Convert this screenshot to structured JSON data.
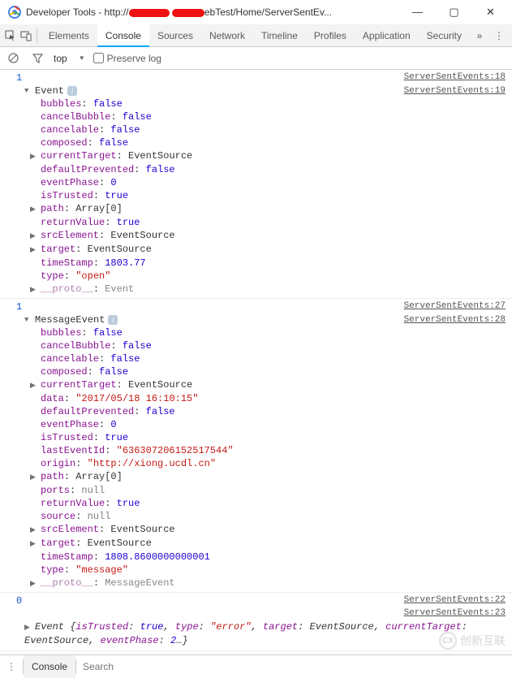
{
  "window": {
    "title_prefix": "Developer Tools - http://",
    "title_mid": "ebTest/Home/ServerSentEv...",
    "btn_min": "—",
    "btn_max": "▢",
    "btn_close": "✕"
  },
  "tabs": {
    "elements": "Elements",
    "console": "Console",
    "sources": "Sources",
    "network": "Network",
    "timeline": "Timeline",
    "profiles": "Profiles",
    "application": "Application",
    "security": "Security",
    "overflow": "»",
    "menu": "⋮"
  },
  "toolbar": {
    "context": "top",
    "preserve_log": "Preserve log"
  },
  "console": {
    "entry1": {
      "count": "1",
      "src_head": "ServerSentEvents:18",
      "obj": "Event",
      "src_obj": "ServerSentEvents:19",
      "props": [
        {
          "k": "bubbles",
          "v": "false",
          "t": "bool"
        },
        {
          "k": "cancelBubble",
          "v": "false",
          "t": "bool"
        },
        {
          "k": "cancelable",
          "v": "false",
          "t": "bool"
        },
        {
          "k": "composed",
          "v": "false",
          "t": "bool"
        },
        {
          "k": "currentTarget",
          "v": "EventSource",
          "t": "obj",
          "exp": true
        },
        {
          "k": "defaultPrevented",
          "v": "false",
          "t": "bool"
        },
        {
          "k": "eventPhase",
          "v": "0",
          "t": "num"
        },
        {
          "k": "isTrusted",
          "v": "true",
          "t": "bool"
        },
        {
          "k": "path",
          "v": "Array[0]",
          "t": "obj",
          "exp": true
        },
        {
          "k": "returnValue",
          "v": "true",
          "t": "bool"
        },
        {
          "k": "srcElement",
          "v": "EventSource",
          "t": "obj",
          "exp": true
        },
        {
          "k": "target",
          "v": "EventSource",
          "t": "obj",
          "exp": true
        },
        {
          "k": "timeStamp",
          "v": "1803.77",
          "t": "num"
        },
        {
          "k": "type",
          "v": "\"open\"",
          "t": "str"
        },
        {
          "k": "__proto__",
          "v": "Event",
          "t": "obj",
          "exp": true,
          "dim": true
        }
      ]
    },
    "entry2": {
      "count": "1",
      "src_head": "ServerSentEvents:27",
      "obj": "MessageEvent",
      "src_obj": "ServerSentEvents:28",
      "props": [
        {
          "k": "bubbles",
          "v": "false",
          "t": "bool"
        },
        {
          "k": "cancelBubble",
          "v": "false",
          "t": "bool"
        },
        {
          "k": "cancelable",
          "v": "false",
          "t": "bool"
        },
        {
          "k": "composed",
          "v": "false",
          "t": "bool"
        },
        {
          "k": "currentTarget",
          "v": "EventSource",
          "t": "obj",
          "exp": true
        },
        {
          "k": "data",
          "v": "\"2017/05/18 16:10:15\"",
          "t": "str"
        },
        {
          "k": "defaultPrevented",
          "v": "false",
          "t": "bool"
        },
        {
          "k": "eventPhase",
          "v": "0",
          "t": "num"
        },
        {
          "k": "isTrusted",
          "v": "true",
          "t": "bool"
        },
        {
          "k": "lastEventId",
          "v": "\"636307206152517544\"",
          "t": "str"
        },
        {
          "k": "origin",
          "v": "\"http://xiong.ucdl.cn\"",
          "t": "str"
        },
        {
          "k": "path",
          "v": "Array[0]",
          "t": "obj",
          "exp": true
        },
        {
          "k": "ports",
          "v": "null",
          "t": "null"
        },
        {
          "k": "returnValue",
          "v": "true",
          "t": "bool"
        },
        {
          "k": "source",
          "v": "null",
          "t": "null"
        },
        {
          "k": "srcElement",
          "v": "EventSource",
          "t": "obj",
          "exp": true
        },
        {
          "k": "target",
          "v": "EventSource",
          "t": "obj",
          "exp": true
        },
        {
          "k": "timeStamp",
          "v": "1808.8600000000001",
          "t": "num"
        },
        {
          "k": "type",
          "v": "\"message\"",
          "t": "str"
        },
        {
          "k": "__proto__",
          "v": "MessageEvent",
          "t": "obj",
          "exp": true,
          "dim": true
        }
      ]
    },
    "entry3": {
      "count": "0",
      "src_head": "ServerSentEvents:22",
      "src_obj": "ServerSentEvents:23",
      "body_html": "Event {<span class='k'>isTrusted</span>: <span class='v-bool'>true</span>, <span class='k'>type</span>: <span class='v-str'>\"error\"</span>, <span class='k'>target</span>: EventSource, <span class='k'>currentTarget</span>: EventSource, <span class='k'>eventPhase</span>: <span class='v-num'>2</span>…}"
    }
  },
  "bottom": {
    "console": "Console",
    "search_placeholder": "Search"
  },
  "watermark": "创新互联"
}
